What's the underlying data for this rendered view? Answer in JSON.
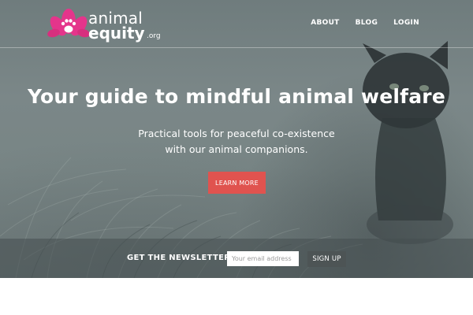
{
  "brand": {
    "name_line1": "animal",
    "name_line2": "equity",
    "tld": ".org",
    "logo_colors": {
      "petal": "#e4358b",
      "paw": "#ffffff"
    }
  },
  "nav": {
    "items": [
      {
        "label": "ABOUT"
      },
      {
        "label": "BLOG"
      },
      {
        "label": "LOGIN"
      }
    ]
  },
  "hero": {
    "headline": "Your guide to mindful animal welfare",
    "subline1": "Practical tools for peaceful co-existence",
    "subline2": "with our animal companions.",
    "cta_label": "LEARN MORE",
    "cta_color": "#e0534f"
  },
  "newsletter": {
    "label": "GET THE NEWSLETTER:",
    "email_placeholder": "Your email address",
    "email_value": "",
    "button_label": "SIGN UP"
  }
}
